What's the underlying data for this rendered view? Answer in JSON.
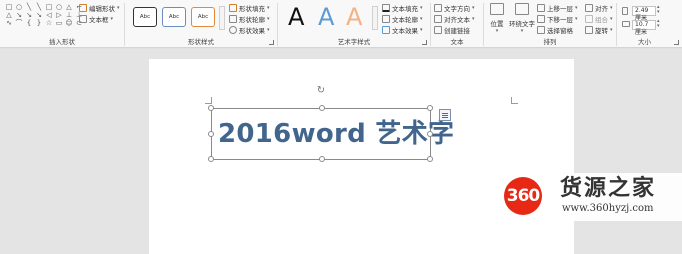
{
  "ribbon": {
    "insert_shapes": {
      "shape_glyphs": [
        "□",
        "○",
        "╲",
        "╲",
        "□",
        "○",
        "△",
        "⌐",
        "△",
        "↘",
        "↘",
        "↘",
        "◁",
        "▷",
        "⊥",
        "⊥",
        "∿",
        "⌒",
        "{",
        "}",
        "☆",
        "▭",
        "☺",
        "⊂"
      ],
      "edit_shape_label": "编辑形状",
      "text_box_label": "文本框",
      "group_label": "插入形状"
    },
    "shape_styles": {
      "sample_text": [
        "Abc",
        "Abc",
        "Abc"
      ],
      "fill_label": "形状填充",
      "outline_label": "形状轮廓",
      "effects_label": "形状效果",
      "group_label": "形状样式"
    },
    "wordart_styles": {
      "letters": [
        "A",
        "A",
        "A"
      ],
      "letter_colors": [
        "#111111",
        "#5b9bd5",
        "#f4b183"
      ],
      "text_fill_label": "文本填充",
      "text_outline_label": "文本轮廓",
      "text_effects_label": "文本效果",
      "group_label": "艺术字样式"
    },
    "text": {
      "direction_label": "文字方向",
      "align_label": "对齐文本",
      "link_label": "创建链接",
      "group_label": "文本"
    },
    "arrange": {
      "position_label": "位置",
      "wrap_label": "环绕文字",
      "forward_label": "上移一层",
      "backward_label": "下移一层",
      "pane_label": "选择窗格",
      "align_label": "对齐",
      "group_btn_label": "组合",
      "rotate_label": "旋转",
      "group_label": "排列"
    },
    "size": {
      "height_value": "2.49 厘米",
      "width_value": "10.7 厘米",
      "group_label": "大小"
    }
  },
  "document": {
    "wordart_text": "2016word 艺术字",
    "wordart_color": "#41658d"
  },
  "watermark": {
    "logo_text": "360",
    "title": "货源之家",
    "url": "www.360hyzj.com"
  }
}
